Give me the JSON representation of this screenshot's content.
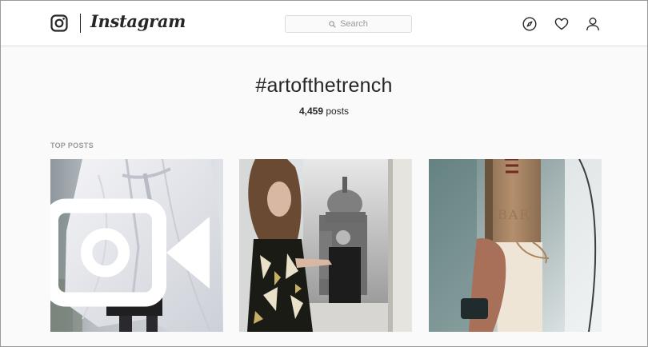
{
  "app": {
    "name": "Instagram"
  },
  "header": {
    "search_placeholder": "Search",
    "icons": [
      "instagram-camera-icon",
      "explore-icon",
      "heart-icon",
      "profile-icon"
    ]
  },
  "hashtag": {
    "title": "#artofthetrench",
    "post_count": "4,459",
    "post_count_suffix": "posts"
  },
  "sections": {
    "top_posts_label": "TOP POSTS"
  },
  "posts": [
    {
      "kind": "video",
      "icon": "video-icon"
    },
    {
      "kind": "image"
    },
    {
      "kind": "image"
    }
  ]
}
